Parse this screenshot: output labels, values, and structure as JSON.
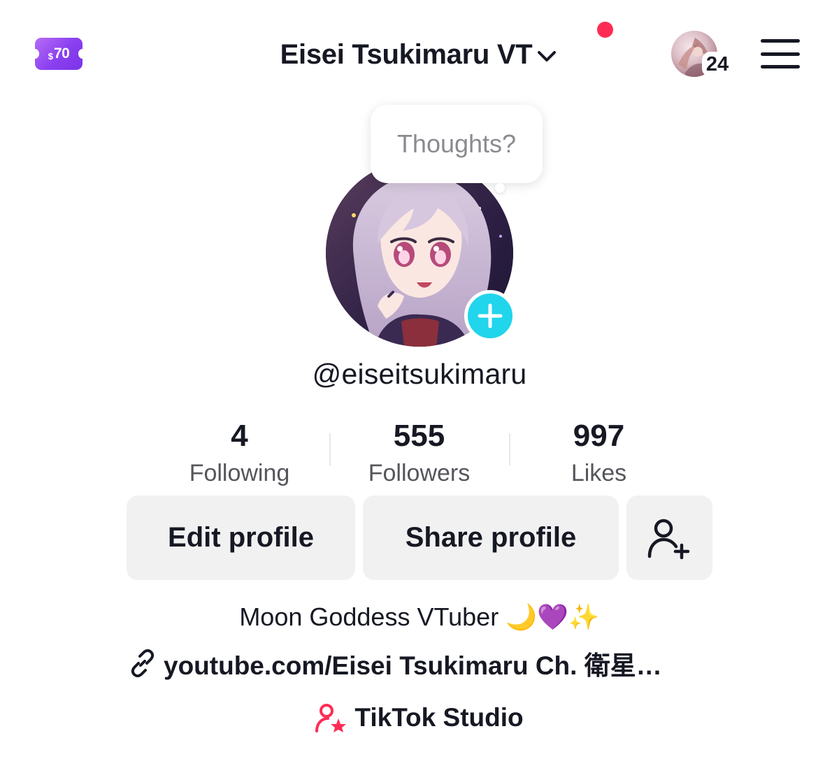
{
  "header": {
    "coupon_currency": "$",
    "coupon_amount": "70",
    "account_name": "Eisei Tsukimaru VT",
    "inbox_count": "24"
  },
  "profile": {
    "prompt_bubble": "Thoughts?",
    "username": "@eiseitsukimaru",
    "stats": [
      {
        "value": "4",
        "label": "Following"
      },
      {
        "value": "555",
        "label": "Followers"
      },
      {
        "value": "997",
        "label": "Likes"
      }
    ],
    "buttons": {
      "edit": "Edit profile",
      "share": "Share profile"
    },
    "bio": {
      "text": "Moon Goddess VTuber ",
      "emoji_moon": "🌙",
      "emoji_heart": "💜",
      "emoji_sparkles": "✨"
    },
    "link": "youtube.com/Eisei Tsukimaru Ch. 衛星…",
    "studio_label": "TikTok Studio"
  },
  "colors": {
    "accent_red": "#fe2c55",
    "add_cyan": "#20d5ec",
    "coupon_purple": "#8a3ff0",
    "button_gray": "#f1f1f2"
  },
  "icons": [
    "coupon-icon",
    "chevron-down-icon",
    "notification-dot",
    "menu-icon",
    "plus-icon",
    "add-friend-icon",
    "link-icon",
    "creator-studio-icon"
  ]
}
